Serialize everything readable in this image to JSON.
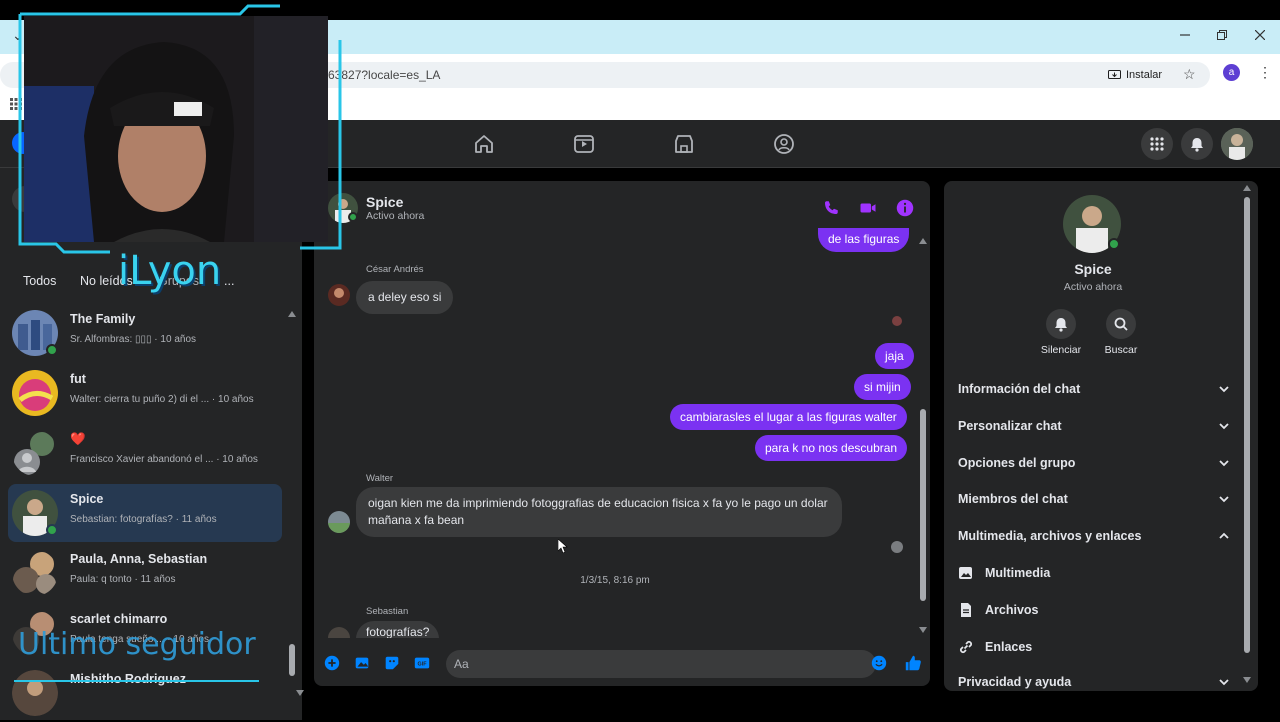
{
  "browser": {
    "url_text": "63827?locale=es_LA",
    "install_label": "Instalar",
    "profile_initial": "a"
  },
  "sidebar": {
    "filters": [
      "Todos",
      "No leídos",
      "Grupos",
      "..."
    ],
    "chats": [
      {
        "name": "The Family",
        "preview": "Sr. Alfombras: ▯▯▯ · 10 años",
        "online": true
      },
      {
        "name": "fut",
        "preview": "Walter: cierra tu puño 2) di el ... · 10 años",
        "online": false
      },
      {
        "name": "❤️",
        "preview": "Francisco Xavier abandonó el ... · 10 años",
        "online": false
      },
      {
        "name": "Spice",
        "preview": "Sebastian: fotografías? · 11 años",
        "online": true,
        "active": true
      },
      {
        "name": "Paula, Anna, Sebastian",
        "preview": "Paula: q tonto · 11 años",
        "online": false
      },
      {
        "name": "scarlet chimarro",
        "preview": "Paula tenga sueño ... · 10 años",
        "online": false
      },
      {
        "name": "Mishitho Rodriguez",
        "preview": "",
        "online": false
      }
    ]
  },
  "conversation": {
    "name": "Spice",
    "status": "Activo ahora",
    "top_partial_bubble": "de las figuras",
    "sender_cesar": "César Andrés",
    "msg_cesar": "a deley eso si",
    "outgoing": [
      "jaja",
      "si mijin",
      "cambiarasles el lugar a las figuras walter",
      "para k no nos descubran"
    ],
    "sender_walter": "Walter",
    "msg_walter": "oigan kien me da imprimiendo fotoggrafias de educacion fisica x fa yo le  pago un dolar mañana x fa bean",
    "timestamp": "1/3/15, 8:16 pm",
    "sender_sebastian": "Sebastian",
    "msg_sebastian": "fotografías?",
    "composer_placeholder": "Aa"
  },
  "info_panel": {
    "name": "Spice",
    "status": "Activo ahora",
    "mute_label": "Silenciar",
    "search_label": "Buscar",
    "sections": [
      "Información del chat",
      "Personalizar chat",
      "Opciones del grupo",
      "Miembros del chat",
      "Multimedia, archivos y enlaces"
    ],
    "media_items": [
      "Multimedia",
      "Archivos",
      "Enlaces"
    ],
    "privacy": "Privacidad y ayuda"
  },
  "stream_overlay": {
    "streamer": "iLyon",
    "last_follower": "Ultimo seguidor"
  },
  "colors": {
    "accent_purple": "#7b32f2",
    "icon_purple": "#a033ff",
    "messenger_blue": "#0084ff",
    "overlay_cyan": "#29c6e8"
  }
}
